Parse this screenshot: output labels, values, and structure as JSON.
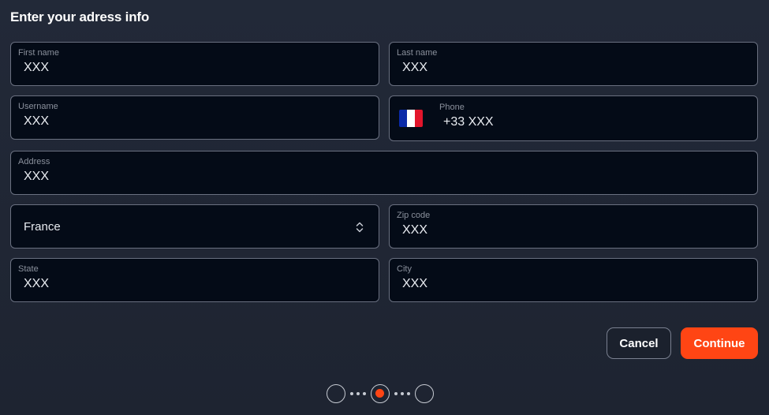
{
  "title": "Enter your adress info",
  "fields": {
    "first_name": {
      "label": "First name",
      "value": "XXX"
    },
    "last_name": {
      "label": "Last name",
      "value": "XXX"
    },
    "username": {
      "label": "Username",
      "value": "XXX"
    },
    "phone": {
      "label": "Phone",
      "value": "+33 XXX",
      "flag": "france-flag-icon"
    },
    "address": {
      "label": "Address",
      "value": "XXX"
    },
    "country": {
      "value": "France",
      "icon": "chevron-up-down-icon"
    },
    "zip": {
      "label": "Zip code",
      "value": "XXX"
    },
    "state": {
      "label": "State",
      "value": "XXX"
    },
    "city": {
      "label": "City",
      "value": "XXX"
    }
  },
  "buttons": {
    "cancel": "Cancel",
    "continue": "Continue"
  },
  "stepper": {
    "total_steps": 3,
    "current_step": 2
  },
  "colors": {
    "accent": "#ff4514",
    "background": "#1f2533",
    "field_background": "#040b17",
    "field_border": "#6a7080",
    "flag_blue": "#0b2aa8",
    "flag_white": "#ffffff",
    "flag_red": "#e3152b"
  }
}
